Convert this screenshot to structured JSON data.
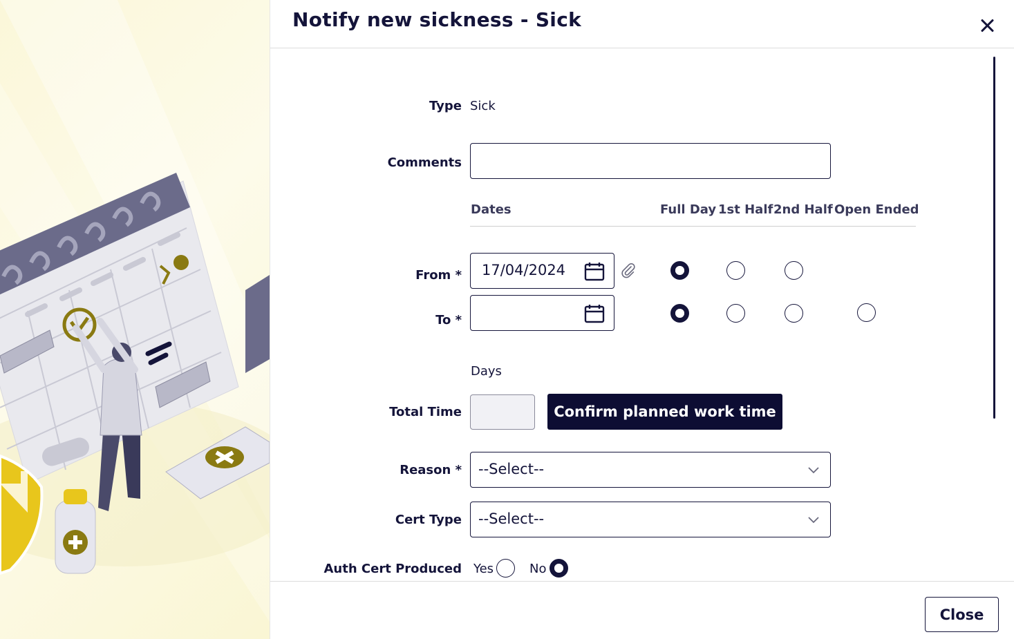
{
  "dialog": {
    "title": "Notify new sickness - Sick",
    "close_icon": "close-icon"
  },
  "form": {
    "type_label": "Type",
    "type_value": "Sick",
    "comments_label": "Comments",
    "comments_value": "",
    "columns": {
      "dates": "Dates",
      "full_day": "Full Day",
      "first_half": "1st Half",
      "second_half": "2nd Half",
      "open_ended": "Open Ended"
    },
    "from_label": "From *",
    "from_value": "17/04/2024",
    "from_selected": "Full Day",
    "to_label": "To *",
    "to_value": "",
    "to_selected": "Full Day",
    "days_label": "Days",
    "total_time_label": "Total Time",
    "total_time_value": "",
    "confirm_button": "Confirm planned work time",
    "reason_label": "Reason *",
    "reason_value": "--Select--",
    "cert_type_label": "Cert Type",
    "cert_type_value": "--Select--",
    "auth_cert_label": "Auth Cert Produced",
    "auth_cert_yes": "Yes",
    "auth_cert_no": "No",
    "auth_cert_selected": "No"
  },
  "footer": {
    "close_button": "Close"
  },
  "colors": {
    "primary": "#0d0d33",
    "text": "#14143a",
    "illustration_bg": "#fbf7d9",
    "accent_olive": "#8a7a12",
    "accent_yellow": "#e8c61c"
  }
}
